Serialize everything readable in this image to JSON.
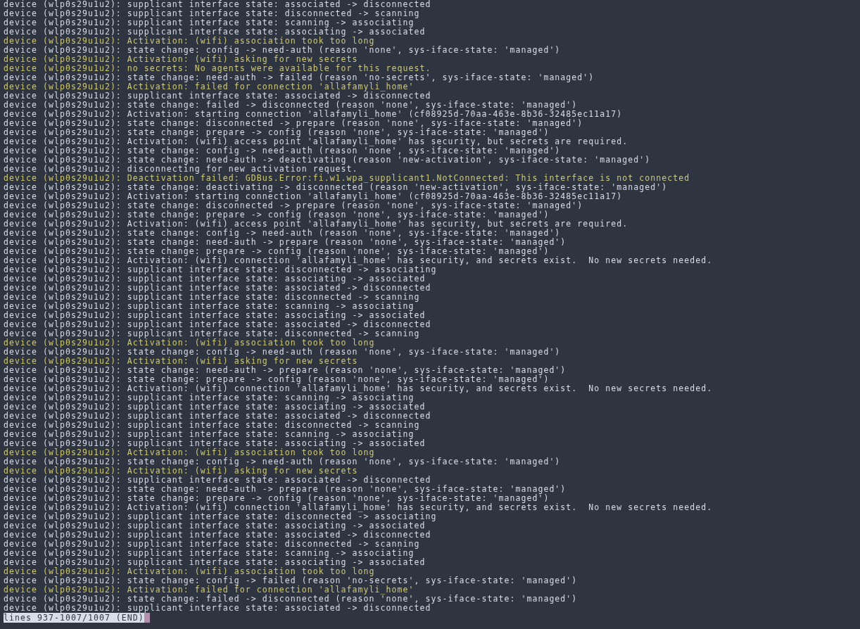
{
  "log_lines": [
    {
      "kind": "normal",
      "text": "device (wlp0s29u1u2): supplicant interface state: associated -> disconnected"
    },
    {
      "kind": "normal",
      "text": "device (wlp0s29u1u2): supplicant interface state: disconnected -> scanning"
    },
    {
      "kind": "normal",
      "text": "device (wlp0s29u1u2): supplicant interface state: scanning -> associating"
    },
    {
      "kind": "normal",
      "text": "device (wlp0s29u1u2): supplicant interface state: associating -> associated"
    },
    {
      "kind": "warning",
      "text": "device (wlp0s29u1u2): Activation: (wifi) association took too long"
    },
    {
      "kind": "normal",
      "text": "device (wlp0s29u1u2): state change: config -> need-auth (reason 'none', sys-iface-state: 'managed')"
    },
    {
      "kind": "warning",
      "text": "device (wlp0s29u1u2): Activation: (wifi) asking for new secrets"
    },
    {
      "kind": "warning",
      "text": "device (wlp0s29u1u2): no secrets: No agents were available for this request."
    },
    {
      "kind": "normal",
      "text": "device (wlp0s29u1u2): state change: need-auth -> failed (reason 'no-secrets', sys-iface-state: 'managed')"
    },
    {
      "kind": "warning",
      "text": "device (wlp0s29u1u2): Activation: failed for connection 'allafamyli_home'"
    },
    {
      "kind": "normal",
      "text": "device (wlp0s29u1u2): supplicant interface state: associated -> disconnected"
    },
    {
      "kind": "normal",
      "text": "device (wlp0s29u1u2): state change: failed -> disconnected (reason 'none', sys-iface-state: 'managed')"
    },
    {
      "kind": "normal",
      "text": "device (wlp0s29u1u2): Activation: starting connection 'allafamyli_home' (cf08925d-70aa-463e-8b36-32485ec11a17)"
    },
    {
      "kind": "normal",
      "text": "device (wlp0s29u1u2): state change: disconnected -> prepare (reason 'none', sys-iface-state: 'managed')"
    },
    {
      "kind": "normal",
      "text": "device (wlp0s29u1u2): state change: prepare -> config (reason 'none', sys-iface-state: 'managed')"
    },
    {
      "kind": "normal",
      "text": "device (wlp0s29u1u2): Activation: (wifi) access point 'allafamyli_home' has security, but secrets are required."
    },
    {
      "kind": "normal",
      "text": "device (wlp0s29u1u2): state change: config -> need-auth (reason 'none', sys-iface-state: 'managed')"
    },
    {
      "kind": "normal",
      "text": "device (wlp0s29u1u2): state change: need-auth -> deactivating (reason 'new-activation', sys-iface-state: 'managed')"
    },
    {
      "kind": "normal",
      "text": "device (wlp0s29u1u2): disconnecting for new activation request."
    },
    {
      "kind": "warning",
      "text": "device (wlp0s29u1u2): Deactivation failed: GDBus.Error:fi.w1.wpa_supplicant1.NotConnected: This interface is not connected"
    },
    {
      "kind": "normal",
      "text": "device (wlp0s29u1u2): state change: deactivating -> disconnected (reason 'new-activation', sys-iface-state: 'managed')"
    },
    {
      "kind": "normal",
      "text": "device (wlp0s29u1u2): Activation: starting connection 'allafamyli_home' (cf08925d-70aa-463e-8b36-32485ec11a17)"
    },
    {
      "kind": "normal",
      "text": "device (wlp0s29u1u2): state change: disconnected -> prepare (reason 'none', sys-iface-state: 'managed')"
    },
    {
      "kind": "normal",
      "text": "device (wlp0s29u1u2): state change: prepare -> config (reason 'none', sys-iface-state: 'managed')"
    },
    {
      "kind": "normal",
      "text": "device (wlp0s29u1u2): Activation: (wifi) access point 'allafamyli_home' has security, but secrets are required."
    },
    {
      "kind": "normal",
      "text": "device (wlp0s29u1u2): state change: config -> need-auth (reason 'none', sys-iface-state: 'managed')"
    },
    {
      "kind": "normal",
      "text": "device (wlp0s29u1u2): state change: need-auth -> prepare (reason 'none', sys-iface-state: 'managed')"
    },
    {
      "kind": "normal",
      "text": "device (wlp0s29u1u2): state change: prepare -> config (reason 'none', sys-iface-state: 'managed')"
    },
    {
      "kind": "normal",
      "text": "device (wlp0s29u1u2): Activation: (wifi) connection 'allafamyli_home' has security, and secrets exist.  No new secrets needed."
    },
    {
      "kind": "normal",
      "text": "device (wlp0s29u1u2): supplicant interface state: disconnected -> associating"
    },
    {
      "kind": "normal",
      "text": "device (wlp0s29u1u2): supplicant interface state: associating -> associated"
    },
    {
      "kind": "normal",
      "text": "device (wlp0s29u1u2): supplicant interface state: associated -> disconnected"
    },
    {
      "kind": "normal",
      "text": "device (wlp0s29u1u2): supplicant interface state: disconnected -> scanning"
    },
    {
      "kind": "normal",
      "text": "device (wlp0s29u1u2): supplicant interface state: scanning -> associating"
    },
    {
      "kind": "normal",
      "text": "device (wlp0s29u1u2): supplicant interface state: associating -> associated"
    },
    {
      "kind": "normal",
      "text": "device (wlp0s29u1u2): supplicant interface state: associated -> disconnected"
    },
    {
      "kind": "normal",
      "text": "device (wlp0s29u1u2): supplicant interface state: disconnected -> scanning"
    },
    {
      "kind": "warning",
      "text": "device (wlp0s29u1u2): Activation: (wifi) association took too long"
    },
    {
      "kind": "normal",
      "text": "device (wlp0s29u1u2): state change: config -> need-auth (reason 'none', sys-iface-state: 'managed')"
    },
    {
      "kind": "warning",
      "text": "device (wlp0s29u1u2): Activation: (wifi) asking for new secrets"
    },
    {
      "kind": "normal",
      "text": "device (wlp0s29u1u2): state change: need-auth -> prepare (reason 'none', sys-iface-state: 'managed')"
    },
    {
      "kind": "normal",
      "text": "device (wlp0s29u1u2): state change: prepare -> config (reason 'none', sys-iface-state: 'managed')"
    },
    {
      "kind": "normal",
      "text": "device (wlp0s29u1u2): Activation: (wifi) connection 'allafamyli_home' has security, and secrets exist.  No new secrets needed."
    },
    {
      "kind": "normal",
      "text": "device (wlp0s29u1u2): supplicant interface state: scanning -> associating"
    },
    {
      "kind": "normal",
      "text": "device (wlp0s29u1u2): supplicant interface state: associating -> associated"
    },
    {
      "kind": "normal",
      "text": "device (wlp0s29u1u2): supplicant interface state: associated -> disconnected"
    },
    {
      "kind": "normal",
      "text": "device (wlp0s29u1u2): supplicant interface state: disconnected -> scanning"
    },
    {
      "kind": "normal",
      "text": "device (wlp0s29u1u2): supplicant interface state: scanning -> associating"
    },
    {
      "kind": "normal",
      "text": "device (wlp0s29u1u2): supplicant interface state: associating -> associated"
    },
    {
      "kind": "warning",
      "text": "device (wlp0s29u1u2): Activation: (wifi) association took too long"
    },
    {
      "kind": "normal",
      "text": "device (wlp0s29u1u2): state change: config -> need-auth (reason 'none', sys-iface-state: 'managed')"
    },
    {
      "kind": "warning",
      "text": "device (wlp0s29u1u2): Activation: (wifi) asking for new secrets"
    },
    {
      "kind": "normal",
      "text": "device (wlp0s29u1u2): supplicant interface state: associated -> disconnected"
    },
    {
      "kind": "normal",
      "text": "device (wlp0s29u1u2): state change: need-auth -> prepare (reason 'none', sys-iface-state: 'managed')"
    },
    {
      "kind": "normal",
      "text": "device (wlp0s29u1u2): state change: prepare -> config (reason 'none', sys-iface-state: 'managed')"
    },
    {
      "kind": "normal",
      "text": "device (wlp0s29u1u2): Activation: (wifi) connection 'allafamyli_home' has security, and secrets exist.  No new secrets needed."
    },
    {
      "kind": "normal",
      "text": "device (wlp0s29u1u2): supplicant interface state: disconnected -> associating"
    },
    {
      "kind": "normal",
      "text": "device (wlp0s29u1u2): supplicant interface state: associating -> associated"
    },
    {
      "kind": "normal",
      "text": "device (wlp0s29u1u2): supplicant interface state: associated -> disconnected"
    },
    {
      "kind": "normal",
      "text": "device (wlp0s29u1u2): supplicant interface state: disconnected -> scanning"
    },
    {
      "kind": "normal",
      "text": "device (wlp0s29u1u2): supplicant interface state: scanning -> associating"
    },
    {
      "kind": "normal",
      "text": "device (wlp0s29u1u2): supplicant interface state: associating -> associated"
    },
    {
      "kind": "warning",
      "text": "device (wlp0s29u1u2): Activation: (wifi) association took too long"
    },
    {
      "kind": "normal",
      "text": "device (wlp0s29u1u2): state change: config -> failed (reason 'no-secrets', sys-iface-state: 'managed')"
    },
    {
      "kind": "warning",
      "text": "device (wlp0s29u1u2): Activation: failed for connection 'allafamyli_home'"
    },
    {
      "kind": "normal",
      "text": "device (wlp0s29u1u2): state change: failed -> disconnected (reason 'none', sys-iface-state: 'managed')"
    },
    {
      "kind": "normal",
      "text": "device (wlp0s29u1u2): supplicant interface state: associated -> disconnected"
    }
  ],
  "status_bar": {
    "text": "lines 937-1007/1007 (END)"
  }
}
